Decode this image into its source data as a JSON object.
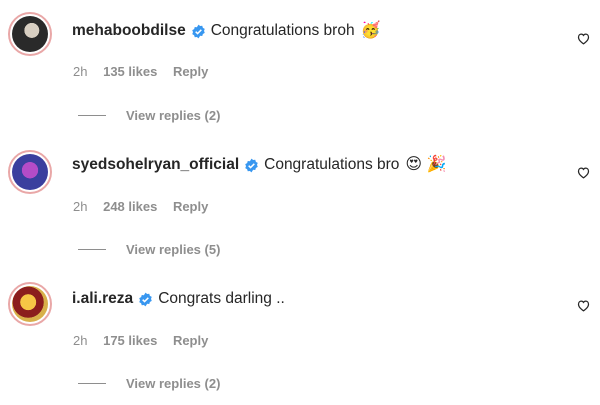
{
  "comments": [
    {
      "username": "mehaboobdilse",
      "text": "Congratulations broh",
      "emoji": "🥳",
      "time": "2h",
      "likes": "135 likes",
      "reply": "Reply",
      "view_replies": "View replies (2)"
    },
    {
      "username": "syedsohelryan_official",
      "text": "Congratulations bro",
      "emoji": "😍 🎉",
      "time": "2h",
      "likes": "248 likes",
      "reply": "Reply",
      "view_replies": "View replies (5)"
    },
    {
      "username": "i.ali.reza",
      "text": "Congrats darling ..",
      "emoji": "",
      "time": "2h",
      "likes": "175 likes",
      "reply": "Reply",
      "view_replies": "View replies (2)"
    }
  ],
  "icons": {
    "verified": "verified-badge-icon",
    "like": "heart-icon"
  },
  "colors": {
    "verified_blue": "#3897f0",
    "meta_gray": "#8e8e8e",
    "text": "#262626"
  }
}
